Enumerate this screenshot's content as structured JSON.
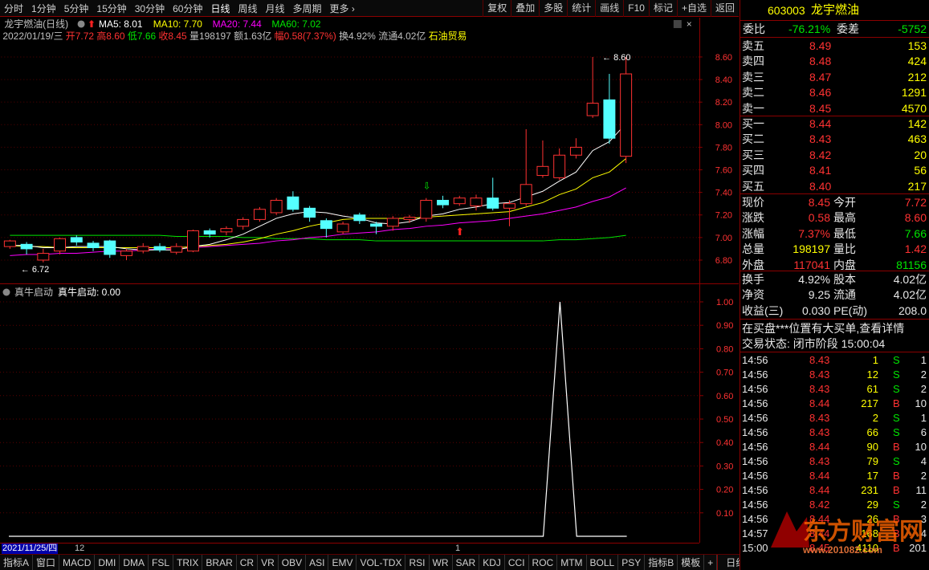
{
  "toolbar": {
    "periods": [
      "分时",
      "1分钟",
      "5分钟",
      "15分钟",
      "30分钟",
      "60分钟",
      "日线",
      "周线",
      "月线",
      "多周期",
      "更多"
    ],
    "active": "日线",
    "buttons": [
      "复权",
      "叠加",
      "多股",
      "统计",
      "画线",
      "F10",
      "标记",
      "+自选",
      "返回"
    ]
  },
  "chart": {
    "name_label": "龙宇燃油(日线)",
    "ma5": "MA5: 8.01",
    "ma10": "MA10: 7.70",
    "ma20": "MA20: 7.44",
    "ma60": "MA60: 7.02",
    "info_date": "2022/01/19/三",
    "info_open": "开7.72",
    "info_high": "高8.60",
    "info_low": "低7.66",
    "info_close": "收8.45",
    "info_vol": "量198197",
    "info_amt": "额1.63亿",
    "info_amp": "幅0.58(7.37%)",
    "info_turn": "换4.92%",
    "info_float": "流通4.02亿",
    "info_sector": "石油贸易",
    "high_mark": "8.60",
    "low_mark": "6.72",
    "ticks": [
      "8.60",
      "8.40",
      "8.20",
      "8.00",
      "7.80",
      "7.60",
      "7.40",
      "7.20",
      "7.00",
      "6.80"
    ]
  },
  "chart_data": {
    "type": "candlestick",
    "ylim": [
      6.7,
      8.7
    ],
    "candles": [
      {
        "o": 6.92,
        "c": 6.97,
        "h": 6.98,
        "l": 6.9
      },
      {
        "o": 6.94,
        "c": 6.9,
        "h": 6.96,
        "l": 6.85
      },
      {
        "o": 6.8,
        "c": 6.86,
        "h": 6.9,
        "l": 6.78
      },
      {
        "o": 6.88,
        "c": 6.99,
        "h": 7.0,
        "l": 6.85
      },
      {
        "o": 7.0,
        "c": 6.96,
        "h": 7.02,
        "l": 6.93
      },
      {
        "o": 6.95,
        "c": 6.91,
        "h": 6.97,
        "l": 6.88
      },
      {
        "o": 6.97,
        "c": 6.85,
        "h": 6.98,
        "l": 6.82
      },
      {
        "o": 6.84,
        "c": 6.88,
        "h": 6.9,
        "l": 6.8
      },
      {
        "o": 6.88,
        "c": 6.92,
        "h": 6.95,
        "l": 6.86
      },
      {
        "o": 6.92,
        "c": 6.89,
        "h": 6.95,
        "l": 6.87
      },
      {
        "o": 6.87,
        "c": 6.92,
        "h": 6.95,
        "l": 6.85
      },
      {
        "o": 6.88,
        "c": 7.06,
        "h": 7.07,
        "l": 6.87
      },
      {
        "o": 7.06,
        "c": 7.03,
        "h": 7.08,
        "l": 7.0
      },
      {
        "o": 7.05,
        "c": 7.08,
        "h": 7.1,
        "l": 7.02
      },
      {
        "o": 7.1,
        "c": 7.16,
        "h": 7.18,
        "l": 7.07
      },
      {
        "o": 7.16,
        "c": 7.25,
        "h": 7.27,
        "l": 7.14
      },
      {
        "o": 7.22,
        "c": 7.33,
        "h": 7.35,
        "l": 7.2
      },
      {
        "o": 7.36,
        "c": 7.25,
        "h": 7.41,
        "l": 7.23
      },
      {
        "o": 7.26,
        "c": 7.18,
        "h": 7.28,
        "l": 7.14
      },
      {
        "o": 7.15,
        "c": 7.08,
        "h": 7.17,
        "l": 7.0
      },
      {
        "o": 7.05,
        "c": 7.12,
        "h": 7.14,
        "l": 7.03
      },
      {
        "o": 7.2,
        "c": 7.15,
        "h": 7.22,
        "l": 7.12
      },
      {
        "o": 7.12,
        "c": 7.1,
        "h": 7.14,
        "l": 7.03
      },
      {
        "o": 7.1,
        "c": 7.17,
        "h": 7.19,
        "l": 7.06
      },
      {
        "o": 7.16,
        "c": 7.18,
        "h": 7.2,
        "l": 7.13
      },
      {
        "o": 7.17,
        "c": 7.33,
        "h": 7.35,
        "l": 7.14
      },
      {
        "o": 7.33,
        "c": 7.29,
        "h": 7.37,
        "l": 7.26
      },
      {
        "o": 7.3,
        "c": 7.35,
        "h": 7.37,
        "l": 7.28
      },
      {
        "o": 7.28,
        "c": 7.35,
        "h": 7.38,
        "l": 7.24
      },
      {
        "o": 7.35,
        "c": 7.26,
        "h": 7.53,
        "l": 7.24
      },
      {
        "o": 7.26,
        "c": 7.3,
        "h": 7.33,
        "l": 7.1
      },
      {
        "o": 7.3,
        "c": 7.47,
        "h": 7.96,
        "l": 7.28
      },
      {
        "o": 7.55,
        "c": 7.63,
        "h": 7.86,
        "l": 7.53
      },
      {
        "o": 7.53,
        "c": 7.73,
        "h": 7.79,
        "l": 7.51
      },
      {
        "o": 7.73,
        "c": 7.8,
        "h": 7.88,
        "l": 7.7
      },
      {
        "o": 8.08,
        "c": 8.19,
        "h": 8.6,
        "l": 8.06
      },
      {
        "o": 8.22,
        "c": 7.88,
        "h": 8.45,
        "l": 7.83
      },
      {
        "o": 7.72,
        "c": 8.45,
        "h": 8.6,
        "l": 7.66
      }
    ],
    "ma5": [
      6.93,
      6.93,
      6.91,
      6.91,
      6.92,
      6.92,
      6.92,
      6.9,
      6.89,
      6.89,
      6.89,
      6.92,
      6.94,
      6.98,
      7.03,
      7.1,
      7.17,
      7.21,
      7.23,
      7.22,
      7.19,
      7.17,
      7.13,
      7.12,
      7.14,
      7.19,
      7.21,
      7.25,
      7.27,
      7.3,
      7.31,
      7.36,
      7.41,
      7.5,
      7.58,
      7.77,
      7.85,
      8.01
    ],
    "ma10": [
      6.93,
      6.92,
      6.92,
      6.91,
      6.91,
      6.91,
      6.91,
      6.91,
      6.91,
      6.91,
      6.91,
      6.92,
      6.93,
      6.94,
      6.96,
      6.99,
      7.03,
      7.06,
      7.1,
      7.13,
      7.16,
      7.17,
      7.17,
      7.17,
      7.17,
      7.18,
      7.19,
      7.2,
      7.21,
      7.22,
      7.23,
      7.27,
      7.31,
      7.38,
      7.43,
      7.53,
      7.58,
      7.7
    ],
    "ma20": [
      6.84,
      6.85,
      6.85,
      6.86,
      6.86,
      6.87,
      6.88,
      6.88,
      6.89,
      6.9,
      6.9,
      6.91,
      6.92,
      6.93,
      6.94,
      6.95,
      6.97,
      6.98,
      7.0,
      7.01,
      7.03,
      7.04,
      7.05,
      7.07,
      7.08,
      7.1,
      7.11,
      7.13,
      7.14,
      7.15,
      7.17,
      7.19,
      7.21,
      7.24,
      7.27,
      7.32,
      7.36,
      7.44
    ],
    "ma60": [
      7.02,
      7.02,
      7.02,
      7.02,
      7.02,
      7.02,
      7.02,
      7.02,
      7.02,
      7.02,
      7.01,
      7.01,
      7.01,
      7.01,
      7.0,
      7.0,
      6.99,
      6.99,
      6.99,
      6.98,
      6.98,
      6.98,
      6.97,
      6.97,
      6.97,
      6.97,
      6.97,
      6.97,
      6.97,
      6.97,
      6.97,
      6.97,
      6.97,
      6.98,
      6.98,
      6.99,
      7.0,
      7.02
    ]
  },
  "indicator": {
    "name": "真牛启动",
    "value_label": "真牛启动: 0.00",
    "ticks": [
      "1.00",
      "0.90",
      "0.80",
      "0.70",
      "0.60",
      "0.50",
      "0.40",
      "0.30",
      "0.20",
      "0.10"
    ],
    "values": [
      0,
      0,
      0,
      0,
      0,
      0,
      0,
      0,
      0,
      0,
      0,
      0,
      0,
      0,
      0,
      0,
      0,
      0,
      0,
      0,
      0,
      0,
      0,
      0,
      0,
      0,
      0,
      0,
      0,
      0,
      0,
      0,
      0,
      1,
      0,
      0,
      0,
      0
    ]
  },
  "date_bar": {
    "start": "2021/11/25/四",
    "m1": "12",
    "m2": "1"
  },
  "bottom_tabs": [
    "指标A",
    "窗口",
    "MACD",
    "DMI",
    "DMA",
    "FSL",
    "TRIX",
    "BRAR",
    "CR",
    "VR",
    "OBV",
    "ASI",
    "EMV",
    "VOL-TDX",
    "RSI",
    "WR",
    "SAR",
    "KDJ",
    "CCI",
    "ROC",
    "MTM",
    "BOLL",
    "PSY"
  ],
  "bottom_right": [
    "指标B",
    "模板",
    "+",
    "日线"
  ],
  "panel": {
    "code": "603003",
    "name": "龙宇燃油",
    "weibi_label": "委比",
    "weibi": "-76.21%",
    "weicha_label": "委差",
    "weicha": "-5752",
    "asks": [
      {
        "label": "卖五",
        "price": "8.49",
        "vol": "153"
      },
      {
        "label": "卖四",
        "price": "8.48",
        "vol": "424"
      },
      {
        "label": "卖三",
        "price": "8.47",
        "vol": "212"
      },
      {
        "label": "卖二",
        "price": "8.46",
        "vol": "1291"
      },
      {
        "label": "卖一",
        "price": "8.45",
        "vol": "4570"
      }
    ],
    "bids": [
      {
        "label": "买一",
        "price": "8.44",
        "vol": "142"
      },
      {
        "label": "买二",
        "price": "8.43",
        "vol": "463"
      },
      {
        "label": "买三",
        "price": "8.42",
        "vol": "20"
      },
      {
        "label": "买四",
        "price": "8.41",
        "vol": "56"
      },
      {
        "label": "买五",
        "price": "8.40",
        "vol": "217"
      }
    ],
    "stats": [
      {
        "l1": "现价",
        "v1": "8.45",
        "l2": "今开",
        "v2": "7.72"
      },
      {
        "l1": "涨跌",
        "v1": "0.58",
        "l2": "最高",
        "v2": "8.60"
      },
      {
        "l1": "涨幅",
        "v1": "7.37%",
        "l2": "最低",
        "v2": "7.66"
      },
      {
        "l1": "总量",
        "v1": "198197",
        "l2": "量比",
        "v2": "1.42"
      },
      {
        "l1": "外盘",
        "v1": "117041",
        "l2": "内盘",
        "v2": "81156"
      }
    ],
    "stats2": [
      {
        "l1": "换手",
        "v1": "4.92%",
        "l2": "股本",
        "v2": "4.02亿"
      },
      {
        "l1": "净资",
        "v1": "9.25",
        "l2": "流通",
        "v2": "4.02亿"
      },
      {
        "l1": "收益(三)",
        "v1": "0.030",
        "l2": "PE(动)",
        "v2": "208.0"
      }
    ],
    "notice": "在买盘***位置有大买单,查看详情",
    "status": "交易状态: 闭市阶段 15:00:04",
    "ticks": [
      {
        "t": "14:56",
        "p": "8.43",
        "v": "1",
        "s": "S",
        "n": "1"
      },
      {
        "t": "14:56",
        "p": "8.43",
        "v": "12",
        "s": "S",
        "n": "2"
      },
      {
        "t": "14:56",
        "p": "8.43",
        "v": "61",
        "s": "S",
        "n": "2"
      },
      {
        "t": "14:56",
        "p": "8.44",
        "v": "217",
        "s": "B",
        "n": "10"
      },
      {
        "t": "14:56",
        "p": "8.43",
        "v": "2",
        "s": "S",
        "n": "1"
      },
      {
        "t": "14:56",
        "p": "8.43",
        "v": "66",
        "s": "S",
        "n": "6"
      },
      {
        "t": "14:56",
        "p": "8.44",
        "v": "90",
        "s": "B",
        "n": "10"
      },
      {
        "t": "14:56",
        "p": "8.43",
        "v": "79",
        "s": "S",
        "n": "4"
      },
      {
        "t": "14:56",
        "p": "8.44",
        "v": "17",
        "s": "B",
        "n": "2"
      },
      {
        "t": "14:56",
        "p": "8.44",
        "v": "231",
        "s": "B",
        "n": "11"
      },
      {
        "t": "14:56",
        "p": "8.42",
        "v": "29",
        "s": "S",
        "n": "2"
      },
      {
        "t": "14:56",
        "p": "8.44",
        "v": "26",
        "s": "B",
        "n": "3"
      },
      {
        "t": "14:57",
        "p": "8.44",
        "v": "168",
        "s": "B",
        "n": "4"
      },
      {
        "t": "15:00",
        "p": "8.45",
        "v": "4110",
        "s": "B",
        "n": "201"
      }
    ]
  },
  "watermark": {
    "brand": "东方财富网",
    "url": "www.201082.com"
  }
}
